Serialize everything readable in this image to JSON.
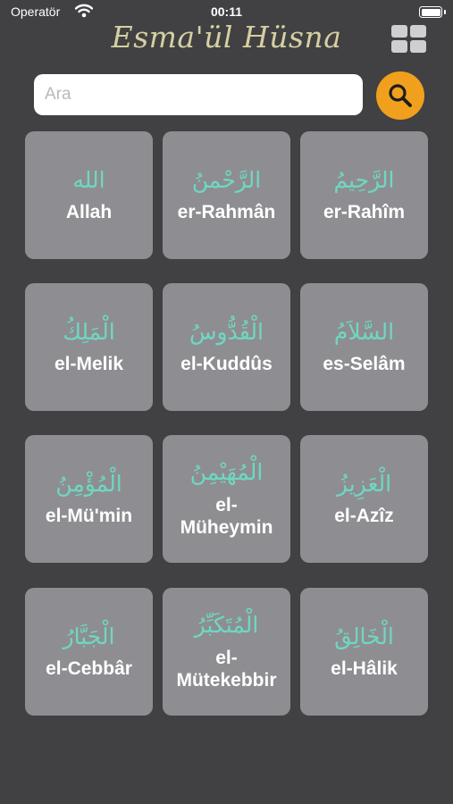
{
  "status_bar": {
    "carrier": "Operatör",
    "time": "00:11",
    "wifi_icon": "wifi-icon",
    "battery_icon": "battery-icon"
  },
  "header": {
    "title": "Esma'ül Hüsna",
    "layout_toggle_icon": "grid-layout-icon"
  },
  "search": {
    "placeholder": "Ara",
    "value": "",
    "button_icon": "search-icon"
  },
  "colors": {
    "background": "#414143",
    "card": "#8e8e92",
    "arabic_text": "#6ed8c2",
    "title": "#d6cfa2",
    "search_button": "#f0a01c"
  },
  "names": [
    {
      "arabic": "الله",
      "latin": "Allah"
    },
    {
      "arabic": "الرَّحْمنُ",
      "latin": "er-Rahmân"
    },
    {
      "arabic": "الرَّحِيمُ",
      "latin": "er-Rahîm"
    },
    {
      "arabic": "الْمَلِكُ",
      "latin": "el-Melik"
    },
    {
      "arabic": "الْقُدُّوسُ",
      "latin": "el-Kuddûs"
    },
    {
      "arabic": "السَّلاَمُ",
      "latin": "es-Selâm"
    },
    {
      "arabic": "الْمُؤْمِنُ",
      "latin": "el-Mü'min"
    },
    {
      "arabic": "الْمُهَيْمِنُ",
      "latin": "el-\nMüheymin"
    },
    {
      "arabic": "الْعَزِيزُ",
      "latin": "el-Azîz"
    },
    {
      "arabic": "الْجَبَّارُ",
      "latin": "el-Cebbâr"
    },
    {
      "arabic": "الْمُتَكَبِّرُ",
      "latin": "el-\nMütekebbir"
    },
    {
      "arabic": "الْخَالِقُ",
      "latin": "el-Hâlik"
    }
  ]
}
